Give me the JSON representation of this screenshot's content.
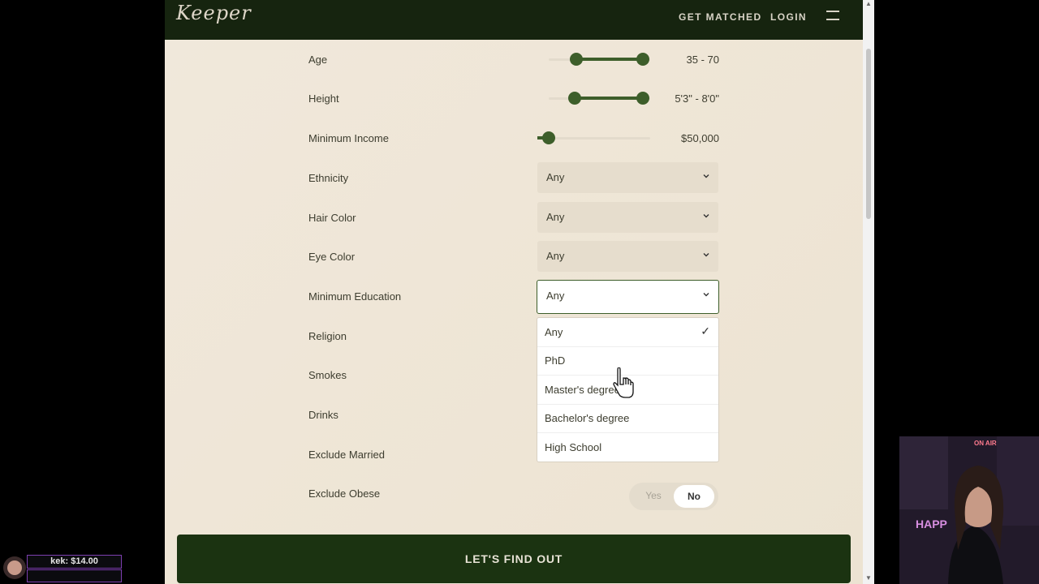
{
  "header": {
    "logo": "Keeper",
    "nav_get_matched": "GET MATCHED",
    "nav_login": "LOGIN",
    "menu_icon": "hamburger-icon"
  },
  "filters": {
    "age": {
      "label": "Age",
      "value": "35 - 70"
    },
    "height": {
      "label": "Height",
      "value": "5'3\" - 8'0\""
    },
    "income": {
      "label": "Minimum Income",
      "value": "$50,000"
    },
    "ethnicity": {
      "label": "Ethnicity",
      "value": "Any"
    },
    "hair_color": {
      "label": "Hair Color",
      "value": "Any"
    },
    "eye_color": {
      "label": "Eye Color",
      "value": "Any"
    },
    "education": {
      "label": "Minimum Education",
      "value": "Any"
    },
    "religion": {
      "label": "Religion"
    },
    "smokes": {
      "label": "Smokes"
    },
    "drinks": {
      "label": "Drinks"
    },
    "exclude_married": {
      "label": "Exclude Married"
    },
    "exclude_obese": {
      "label": "Exclude Obese",
      "yes": "Yes",
      "no": "No"
    }
  },
  "education_options": [
    {
      "label": "Any",
      "selected": true
    },
    {
      "label": "PhD"
    },
    {
      "label": "Master's degree"
    },
    {
      "label": "Bachelor's degree"
    },
    {
      "label": "High School"
    }
  ],
  "check_mark": "✓",
  "cta": {
    "label": "LET'S FIND OUT"
  },
  "stream": {
    "on_air": "ON AIR",
    "sign_text": "HAPP",
    "donation": "kek: $14.00"
  },
  "colors": {
    "accent": "#3d5e2a",
    "header_bg": "#16240f",
    "cta_bg": "#1b3311",
    "page_bg": "#efe7da"
  }
}
